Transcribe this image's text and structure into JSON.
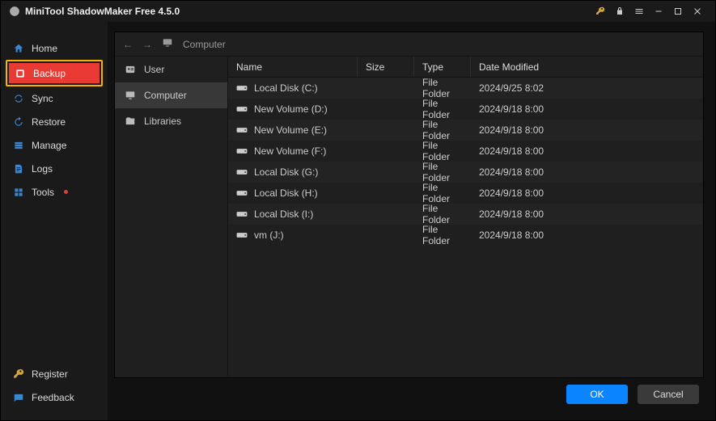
{
  "title": "MiniTool ShadowMaker Free 4.5.0",
  "nav": {
    "home": "Home",
    "backup": "Backup",
    "sync": "Sync",
    "restore": "Restore",
    "manage": "Manage",
    "logs": "Logs",
    "tools": "Tools",
    "register": "Register",
    "feedback": "Feedback"
  },
  "breadcrumb": {
    "label": "Computer"
  },
  "tree": {
    "user": "User",
    "computer": "Computer",
    "libraries": "Libraries"
  },
  "columns": {
    "name": "Name",
    "size": "Size",
    "type": "Type",
    "date": "Date Modified"
  },
  "rows": [
    {
      "name": "Local Disk (C:)",
      "size": "",
      "type": "File Folder",
      "date": "2024/9/25 8:02"
    },
    {
      "name": "New Volume (D:)",
      "size": "",
      "type": "File Folder",
      "date": "2024/9/18 8:00"
    },
    {
      "name": "New Volume (E:)",
      "size": "",
      "type": "File Folder",
      "date": "2024/9/18 8:00"
    },
    {
      "name": "New Volume (F:)",
      "size": "",
      "type": "File Folder",
      "date": "2024/9/18 8:00"
    },
    {
      "name": "Local Disk (G:)",
      "size": "",
      "type": "File Folder",
      "date": "2024/9/18 8:00"
    },
    {
      "name": "Local Disk (H:)",
      "size": "",
      "type": "File Folder",
      "date": "2024/9/18 8:00"
    },
    {
      "name": "Local Disk (I:)",
      "size": "",
      "type": "File Folder",
      "date": "2024/9/18 8:00"
    },
    {
      "name": "vm (J:)",
      "size": "",
      "type": "File Folder",
      "date": "2024/9/18 8:00"
    }
  ],
  "buttons": {
    "ok": "OK",
    "cancel": "Cancel"
  }
}
